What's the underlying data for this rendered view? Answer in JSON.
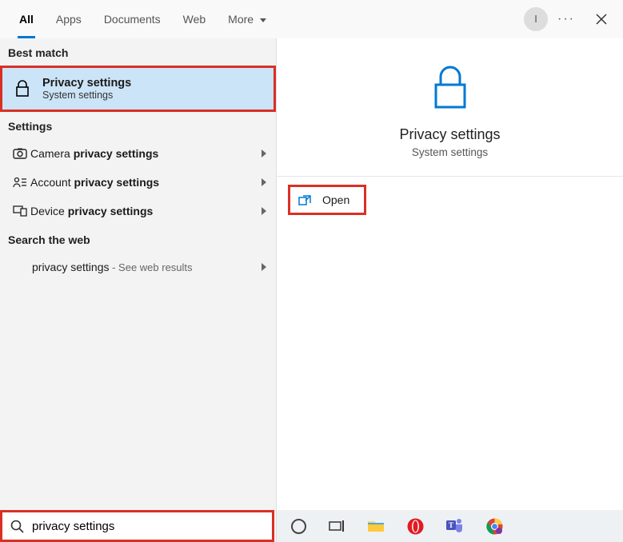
{
  "tabs": {
    "items": [
      {
        "label": "All",
        "active": true
      },
      {
        "label": "Apps",
        "active": false
      },
      {
        "label": "Documents",
        "active": false
      },
      {
        "label": "Web",
        "active": false
      },
      {
        "label": "More",
        "active": false,
        "hasDropdown": true
      }
    ]
  },
  "avatar": {
    "initial": "I"
  },
  "sections": {
    "best_match_header": "Best match",
    "settings_header": "Settings",
    "web_header": "Search the web"
  },
  "best_match": {
    "title": "Privacy settings",
    "subtitle": "System settings"
  },
  "settings_items": [
    {
      "prefix": "Camera ",
      "bold": "privacy settings",
      "icon": "camera"
    },
    {
      "prefix": "Account ",
      "bold": "privacy settings",
      "icon": "account"
    },
    {
      "prefix": "Device ",
      "bold": "privacy settings",
      "icon": "device"
    }
  ],
  "web_results": [
    {
      "query": "privacy settings",
      "suffix": " - See web results"
    }
  ],
  "detail": {
    "title": "Privacy settings",
    "subtitle": "System settings",
    "open_label": "Open"
  },
  "search": {
    "value": "privacy settings"
  },
  "taskbar": {
    "items": [
      "cortana",
      "taskview",
      "explorer",
      "opera",
      "teams",
      "chrome"
    ]
  }
}
